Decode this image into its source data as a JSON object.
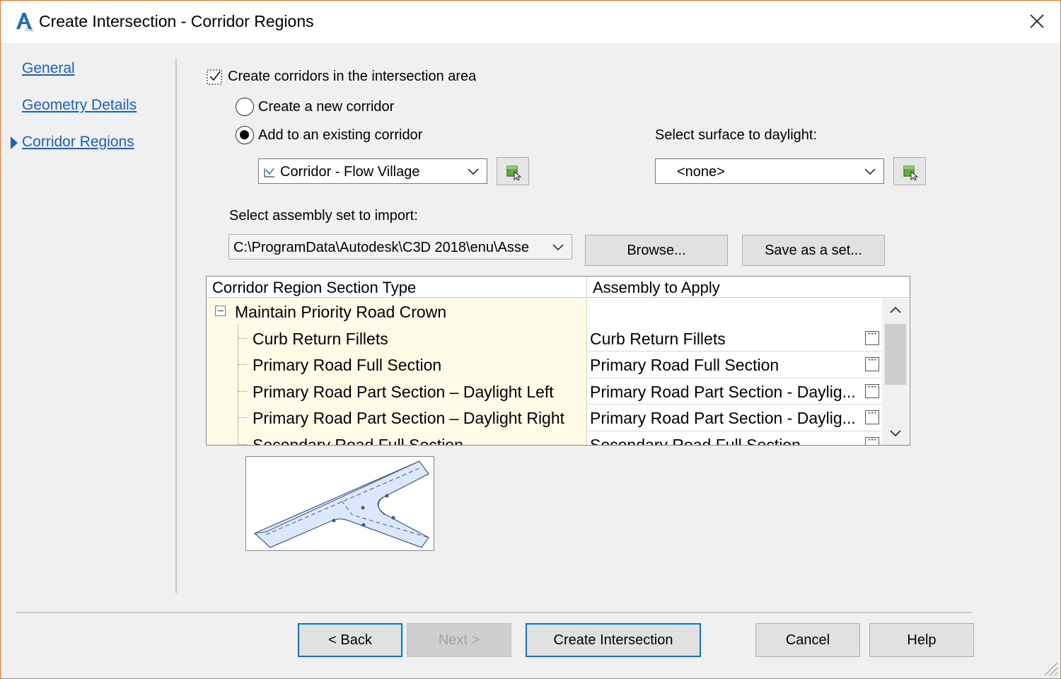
{
  "window": {
    "title": "Create Intersection - Corridor Regions",
    "icon": "autocad-civil3d-app-icon"
  },
  "nav": {
    "items": [
      {
        "label": "General",
        "active": false
      },
      {
        "label": "Geometry Details",
        "active": false
      },
      {
        "label": "Corridor Regions",
        "active": true
      }
    ]
  },
  "options": {
    "create_corridors": {
      "label": "Create corridors in the intersection area",
      "checked": true
    },
    "create_new": {
      "label": "Create a new corridor",
      "selected": false
    },
    "add_existing": {
      "label": "Add to an existing corridor",
      "selected": true
    },
    "corridor_select": {
      "value": "Corridor - Flow Village"
    },
    "daylight_label": "Select surface to daylight:",
    "daylight_select": {
      "value": "<none>"
    },
    "assembly_label": "Select assembly set to import:",
    "assembly_path": "C:\\ProgramData\\Autodesk\\C3D 2018\\enu\\Asse",
    "browse_label": "Browse...",
    "save_set_label": "Save as a set..."
  },
  "grid": {
    "columns": [
      "Corridor Region Section Type",
      "Assembly to Apply"
    ],
    "group": {
      "label": "Maintain Priority Road Crown",
      "expanded": true
    },
    "rows": [
      {
        "type": "Curb Return Fillets",
        "assembly": "Curb Return Fillets"
      },
      {
        "type": "Primary Road Full Section",
        "assembly": "Primary Road Full Section"
      },
      {
        "type": "Primary Road Part Section – Daylight Left",
        "assembly": "Primary Road Part Section - Daylig..."
      },
      {
        "type": "Primary Road Part Section – Daylight Right",
        "assembly": "Primary Road Part Section - Daylig..."
      },
      {
        "type": "Secondary Road Full Section",
        "assembly": "Secondary Road Full Section"
      }
    ]
  },
  "footer": {
    "back": "< Back",
    "next": "Next >",
    "create": "Create Intersection",
    "cancel": "Cancel",
    "help": "Help"
  },
  "colors": {
    "link": "#1a5fd0",
    "focus_border": "#0078d7",
    "grid_highlight": "#fffbe6",
    "window_border": "#e07a3e"
  }
}
